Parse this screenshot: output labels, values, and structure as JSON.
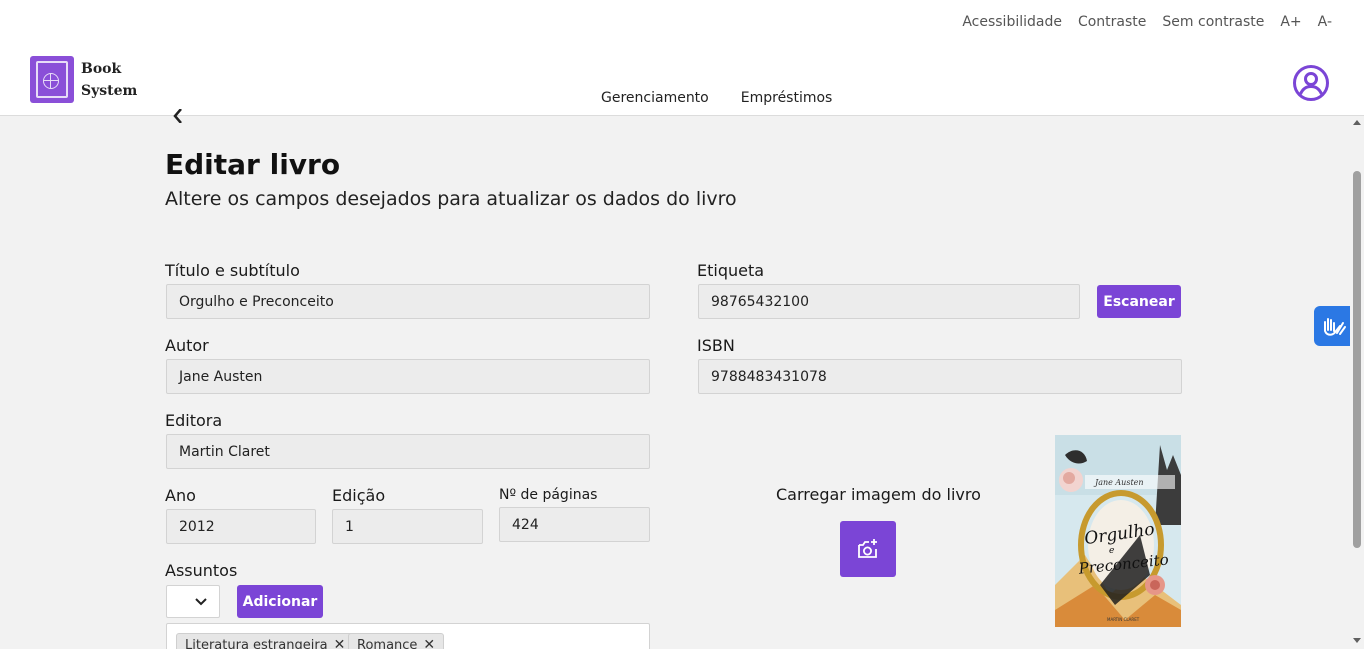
{
  "header": {
    "accessibility_links": [
      "Acessibilidade",
      "Contraste",
      "Sem contraste",
      "A+",
      "A-"
    ],
    "logo_line1": "Book",
    "logo_line2": "System",
    "nav": [
      "Gerenciamento",
      "Empréstimos"
    ]
  },
  "page": {
    "title": "Editar livro",
    "subtitle": "Altere os campos desejados para atualizar os dados do livro"
  },
  "form": {
    "title_label": "Título e subtítulo",
    "title_value": "Orgulho e Preconceito",
    "author_label": "Autor",
    "author_value": "Jane Austen",
    "publisher_label": "Editora",
    "publisher_value": "Martin Claret",
    "year_label": "Ano",
    "year_value": "2012",
    "edition_label": "Edição",
    "edition_value": "1",
    "pages_label": "Nº de páginas",
    "pages_value": "424",
    "tag_label": "Etiqueta",
    "tag_value": "98765432100",
    "scan_button": "Escanear",
    "isbn_label": "ISBN",
    "isbn_value": "9788483431078",
    "subjects_label": "Assuntos",
    "add_button": "Adicionar",
    "subjects": [
      "Literatura estrangeira",
      "Romance"
    ],
    "upload_label": "Carregar imagem do livro"
  },
  "colors": {
    "accent": "#7b45d6",
    "vlibras": "#2b78e4"
  },
  "icons": [
    "book-globe-logo-icon",
    "user-circle-icon",
    "chevron-left-icon",
    "chevron-down-icon",
    "close-icon",
    "camera-add-icon",
    "sign-language-hands-icon"
  ]
}
